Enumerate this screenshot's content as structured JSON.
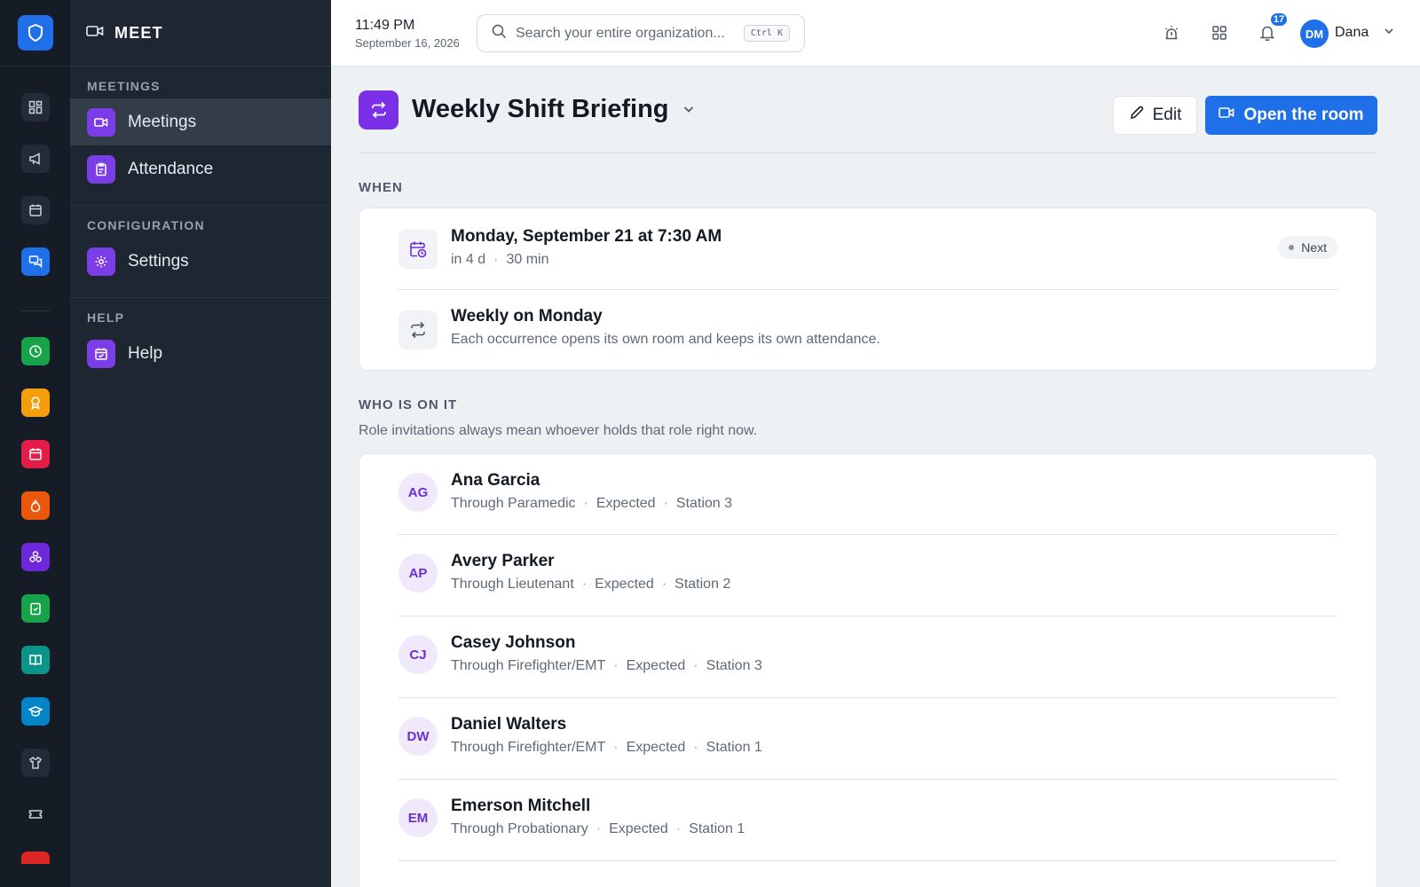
{
  "app": {
    "section_title": "MEET"
  },
  "sidebar": {
    "sections": [
      {
        "label": "MEETINGS",
        "items": [
          {
            "label": "Meetings"
          },
          {
            "label": "Attendance"
          }
        ]
      },
      {
        "label": "CONFIGURATION",
        "items": [
          {
            "label": "Settings"
          }
        ]
      },
      {
        "label": "HELP",
        "items": [
          {
            "label": "Help"
          }
        ]
      }
    ]
  },
  "topbar": {
    "time": "11:49 PM",
    "date": "September 16, 2026",
    "search_placeholder": "Search your entire organization...",
    "search_shortcut": "Ctrl K",
    "notification_count": "17",
    "user_initials": "DM",
    "user_name": "Dana"
  },
  "meeting": {
    "title": "Weekly Shift Briefing",
    "edit_label": "Edit",
    "open_label": "Open the room"
  },
  "when": {
    "heading": "WHEN",
    "next": {
      "title": "Monday, September 21 at 7:30 AM",
      "relative": "in 4 d",
      "duration": "30 min",
      "badge": "Next"
    },
    "recurrence": {
      "title": "Weekly on Monday",
      "note": "Each occurrence opens its own room and keeps its own attendance."
    }
  },
  "who": {
    "heading": "WHO IS ON IT",
    "note": "Role invitations always mean whoever holds that role right now.",
    "people": [
      {
        "initials": "AG",
        "name": "Ana Garcia",
        "through": "Through Paramedic",
        "status": "Expected",
        "station": "Station 3"
      },
      {
        "initials": "AP",
        "name": "Avery Parker",
        "through": "Through Lieutenant",
        "status": "Expected",
        "station": "Station 2"
      },
      {
        "initials": "CJ",
        "name": "Casey Johnson",
        "through": "Through Firefighter/EMT",
        "status": "Expected",
        "station": "Station 3"
      },
      {
        "initials": "DW",
        "name": "Daniel Walters",
        "through": "Through Firefighter/EMT",
        "status": "Expected",
        "station": "Station 1"
      },
      {
        "initials": "EM",
        "name": "Emerson Mitchell",
        "through": "Through Probationary",
        "status": "Expected",
        "station": "Station 1"
      }
    ]
  },
  "colors": {
    "accent": "#1f6fe8",
    "purple": "#7b2fe6",
    "rail_bg": "#151c25",
    "sidebar_bg": "#1d2631"
  }
}
